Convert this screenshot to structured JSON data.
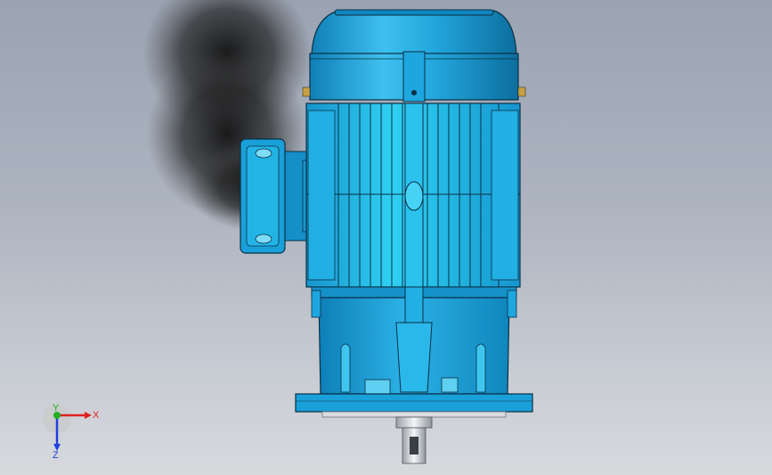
{
  "viewport": {
    "background_top": "#9aa3b2",
    "background_bottom": "#d7d9dd",
    "shadow_color": "#1e1e1e"
  },
  "model": {
    "body_color": "#1aa0d8",
    "highlight_color": "#6fd3f5",
    "dark_color": "#0a6c99",
    "edge_color": "#0b2f44",
    "shaft_color": "#e8ebef"
  },
  "triad": {
    "x_label": "X",
    "y_label": "Y",
    "z_label": "Z",
    "x_color": "#e02020",
    "y_color": "#20b020",
    "z_color": "#2040e0"
  }
}
